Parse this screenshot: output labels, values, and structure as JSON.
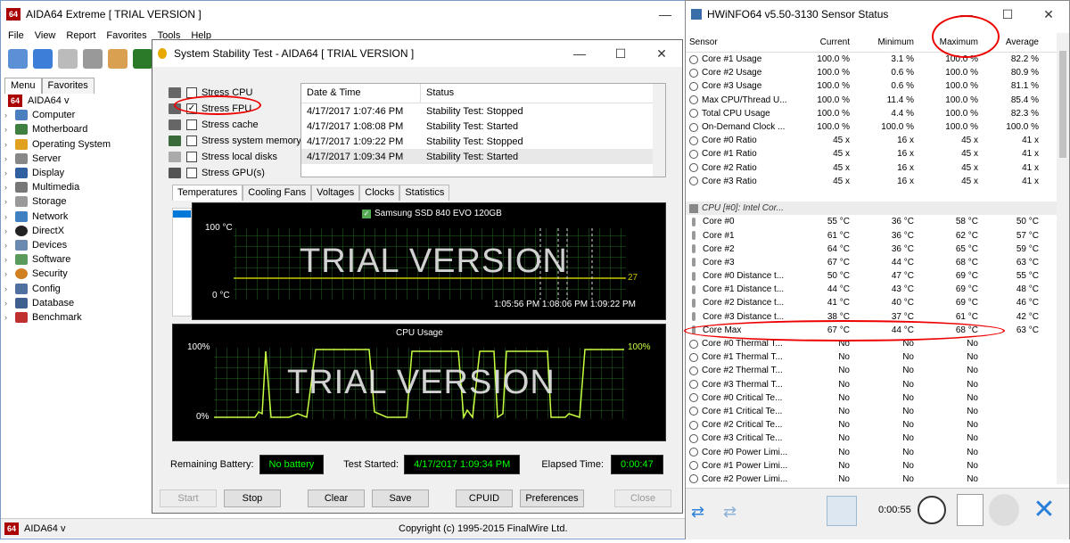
{
  "aida": {
    "title": "AIDA64 Extreme  [ TRIAL VERSION ]",
    "menu": [
      "File",
      "View",
      "Report",
      "Favorites",
      "Tools",
      "Help"
    ],
    "tabs": [
      "Menu",
      "Favorites"
    ],
    "root": "AIDA64 v",
    "tree": [
      "Computer",
      "Motherboard",
      "Operating System",
      "Server",
      "Display",
      "Multimedia",
      "Storage",
      "Network",
      "DirectX",
      "Devices",
      "Software",
      "Security",
      "Config",
      "Database",
      "Benchmark"
    ],
    "status_left": "AIDA64 v",
    "status_right": "Copyright (c) 1995-2015 FinalWire Ltd."
  },
  "sst": {
    "title": "System Stability Test - AIDA64  [ TRIAL VERSION ]",
    "checks": [
      {
        "label": "Stress CPU",
        "checked": false
      },
      {
        "label": "Stress FPU",
        "checked": true
      },
      {
        "label": "Stress cache",
        "checked": false
      },
      {
        "label": "Stress system memory",
        "checked": false
      },
      {
        "label": "Stress local disks",
        "checked": false
      },
      {
        "label": "Stress GPU(s)",
        "checked": false
      }
    ],
    "log_headers": [
      "Date & Time",
      "Status"
    ],
    "log": [
      [
        "4/17/2017 1:07:46 PM",
        "Stability Test: Stopped"
      ],
      [
        "4/17/2017 1:08:08 PM",
        "Stability Test: Started"
      ],
      [
        "4/17/2017 1:09:22 PM",
        "Stability Test: Stopped"
      ],
      [
        "4/17/2017 1:09:34 PM",
        "Stability Test: Started"
      ]
    ],
    "graph_tabs": [
      "Temperatures",
      "Cooling Fans",
      "Voltages",
      "Clocks",
      "Statistics"
    ],
    "temp_legend": "Samsung SSD 840 EVO 120GB",
    "temp_top": "100 °C",
    "temp_bottom": "0 °C",
    "temp_value": "27",
    "temp_time": "1:05:56 PM 1:08:06 PM 1:09:22 PM",
    "watermark": "TRIAL VERSION",
    "cpu_title": "CPU Usage",
    "cpu_top_left": "100%",
    "cpu_bottom": "0%",
    "cpu_top_right": "100%",
    "battery_label": "Remaining Battery:",
    "battery_value": "No battery",
    "started_label": "Test Started:",
    "started_value": "4/17/2017 1:09:34 PM",
    "elapsed_label": "Elapsed Time:",
    "elapsed_value": "0:00:47",
    "buttons": [
      "Start",
      "Stop",
      "Clear",
      "Save",
      "CPUID",
      "Preferences",
      "Close"
    ]
  },
  "hw": {
    "title": "HWiNFO64 v5.50-3130 Sensor Status",
    "headers": [
      "Sensor",
      "Current",
      "Minimum",
      "Maximum",
      "Average"
    ],
    "group": "CPU [#0]: Intel Cor...",
    "rows_top": [
      [
        "Core #1 Usage",
        "100.0 %",
        "3.1 %",
        "100.0 %",
        "82.2 %"
      ],
      [
        "Core #2 Usage",
        "100.0 %",
        "0.6 %",
        "100.0 %",
        "80.9 %"
      ],
      [
        "Core #3 Usage",
        "100.0 %",
        "0.6 %",
        "100.0 %",
        "81.1 %"
      ],
      [
        "Max CPU/Thread U...",
        "100.0 %",
        "11.4 %",
        "100.0 %",
        "85.4 %"
      ],
      [
        "Total CPU Usage",
        "100.0 %",
        "4.4 %",
        "100.0 %",
        "82.3 %"
      ],
      [
        "On-Demand Clock ...",
        "100.0 %",
        "100.0 %",
        "100.0 %",
        "100.0 %"
      ],
      [
        "Core #0 Ratio",
        "45 x",
        "16 x",
        "45 x",
        "41 x"
      ],
      [
        "Core #1 Ratio",
        "45 x",
        "16 x",
        "45 x",
        "41 x"
      ],
      [
        "Core #2 Ratio",
        "45 x",
        "16 x",
        "45 x",
        "41 x"
      ],
      [
        "Core #3 Ratio",
        "45 x",
        "16 x",
        "45 x",
        "41 x"
      ]
    ],
    "rows_temp": [
      [
        "Core #0",
        "55 °C",
        "36 °C",
        "58 °C",
        "50 °C"
      ],
      [
        "Core #1",
        "61 °C",
        "36 °C",
        "62 °C",
        "57 °C"
      ],
      [
        "Core #2",
        "64 °C",
        "36 °C",
        "65 °C",
        "59 °C"
      ],
      [
        "Core #3",
        "67 °C",
        "44 °C",
        "68 °C",
        "63 °C"
      ],
      [
        "Core #0 Distance t...",
        "50 °C",
        "47 °C",
        "69 °C",
        "55 °C"
      ],
      [
        "Core #1 Distance t...",
        "44 °C",
        "43 °C",
        "69 °C",
        "48 °C"
      ],
      [
        "Core #2 Distance t...",
        "41 °C",
        "40 °C",
        "69 °C",
        "46 °C"
      ],
      [
        "Core #3 Distance t...",
        "38 °C",
        "37 °C",
        "61 °C",
        "42 °C"
      ],
      [
        "Core Max",
        "67 °C",
        "44 °C",
        "68 °C",
        "63 °C"
      ]
    ],
    "rows_flag": [
      [
        "Core #0 Thermal T...",
        "No",
        "No",
        "No",
        ""
      ],
      [
        "Core #1 Thermal T...",
        "No",
        "No",
        "No",
        ""
      ],
      [
        "Core #2 Thermal T...",
        "No",
        "No",
        "No",
        ""
      ],
      [
        "Core #3 Thermal T...",
        "No",
        "No",
        "No",
        ""
      ],
      [
        "Core #0 Critical Te...",
        "No",
        "No",
        "No",
        ""
      ],
      [
        "Core #1 Critical Te...",
        "No",
        "No",
        "No",
        ""
      ],
      [
        "Core #2 Critical Te...",
        "No",
        "No",
        "No",
        ""
      ],
      [
        "Core #3 Critical Te...",
        "No",
        "No",
        "No",
        ""
      ],
      [
        "Core #0 Power Limi...",
        "No",
        "No",
        "No",
        ""
      ],
      [
        "Core #1 Power Limi...",
        "No",
        "No",
        "No",
        ""
      ],
      [
        "Core #2 Power Limi...",
        "No",
        "No",
        "No",
        ""
      ]
    ],
    "timer": "0:00:55"
  },
  "colors": {
    "lcd_green": "#00ff00",
    "graph_green": "#7fff00",
    "red_annotation": "#e00000"
  }
}
